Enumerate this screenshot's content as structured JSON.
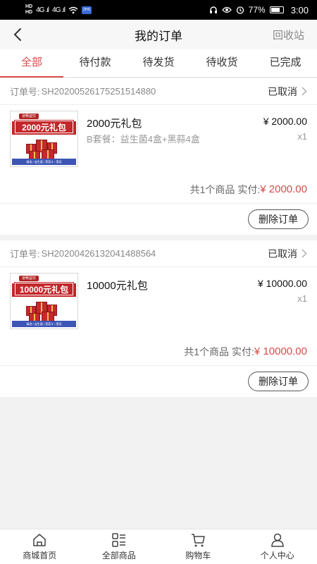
{
  "status_bar": {
    "hd1": "HD",
    "hd2": "HD",
    "signal1": "4G .ıl",
    "signal2": "4G .ıl",
    "badge": "ZHS",
    "battery_level": 77,
    "battery_text": "77%",
    "time": "3:00"
  },
  "header": {
    "title": "我的订单",
    "recycle_label": "回收站"
  },
  "tabs": [
    {
      "label": "全部",
      "active": true
    },
    {
      "label": "待付款",
      "active": false
    },
    {
      "label": "待发货",
      "active": false
    },
    {
      "label": "待收货",
      "active": false
    },
    {
      "label": "已完成",
      "active": false
    }
  ],
  "orders": [
    {
      "order_no_label": "订单号:",
      "order_no": "SH20200526175251514880",
      "status": "已取消",
      "item": {
        "thumb_badge": "道畅益饮",
        "thumb_title": "2000元礼包",
        "thumb_footer": "精选 / 益生菌 / 黑蒜汁 / 黑蒜",
        "name": "2000元礼包",
        "desc": "B套餐：益生菌4盒+黑蒜4盒",
        "price": "¥ 2000.00",
        "qty": "x1"
      },
      "summary_count": "共1个商品",
      "summary_paid_label": "实付:",
      "summary_amount": "¥ 2000.00",
      "delete_label": "删除订单"
    },
    {
      "order_no_label": "订单号:",
      "order_no": "SH20200426132041488564",
      "status": "已取消",
      "item": {
        "thumb_badge": "道畅益饮",
        "thumb_title": "10000元礼包",
        "thumb_footer": "精选 / 益生菌 / 黑蒜汁 / 黑蒜",
        "name": "10000元礼包",
        "desc": "",
        "price": "¥ 10000.00",
        "qty": "x1"
      },
      "summary_count": "共1个商品",
      "summary_paid_label": "实付:",
      "summary_amount": "¥ 10000.00",
      "delete_label": "删除订单"
    }
  ],
  "bottom_nav": [
    {
      "label": "商城首页",
      "icon": "home-icon"
    },
    {
      "label": "全部商品",
      "icon": "category-icon"
    },
    {
      "label": "购物车",
      "icon": "cart-icon"
    },
    {
      "label": "个人中心",
      "icon": "user-icon"
    }
  ],
  "colors": {
    "accent": "#d84a4a",
    "product_red": "#c3272b"
  }
}
